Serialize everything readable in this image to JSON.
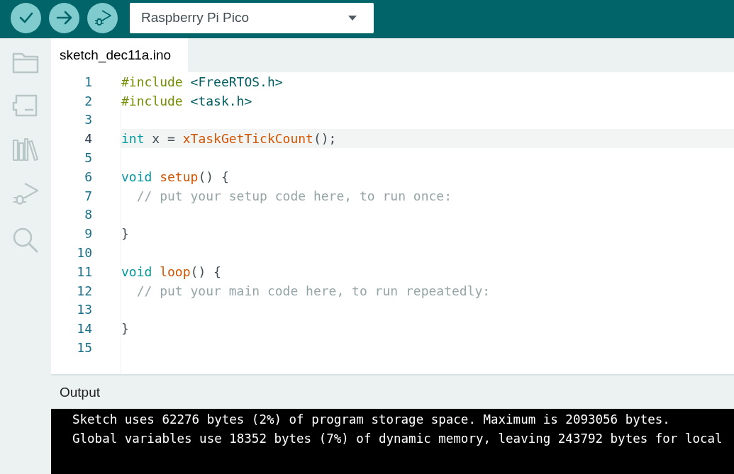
{
  "toolbar": {
    "board_selector": {
      "value": "Raspberry Pi Pico"
    }
  },
  "tabs": [
    {
      "label": "sketch_dec11a.ino",
      "selected": true
    }
  ],
  "editor": {
    "lines": [
      {
        "number": "1",
        "current": false,
        "tokens": [
          {
            "text": "#include",
            "kind": "directive"
          },
          {
            "text": " <FreeRTOS.h>",
            "kind": "header"
          }
        ]
      },
      {
        "number": "2",
        "current": false,
        "tokens": [
          {
            "text": "#include",
            "kind": "directive"
          },
          {
            "text": " <task.h>",
            "kind": "header"
          }
        ]
      },
      {
        "number": "3",
        "current": false
      },
      {
        "number": "4",
        "current": true,
        "tokens": [
          {
            "text": "int",
            "kind": "keyword"
          },
          {
            "text": " x = ",
            "kind": "plain"
          },
          {
            "text": "xTaskGetTickCount",
            "kind": "function"
          },
          {
            "text": "();",
            "kind": "plain"
          }
        ]
      },
      {
        "number": "5",
        "current": false
      },
      {
        "number": "6",
        "current": false,
        "tokens": [
          {
            "text": "void ",
            "kind": "keyword"
          },
          {
            "text": "setup",
            "kind": "function"
          },
          {
            "text": "() {",
            "kind": "plain"
          }
        ]
      },
      {
        "number": "7",
        "current": false,
        "tokens": [
          {
            "text": "  // put your setup code here, to run once:",
            "kind": "comment"
          }
        ]
      },
      {
        "number": "8",
        "current": false
      },
      {
        "number": "9",
        "current": false,
        "tokens": [
          {
            "text": "}",
            "kind": "plain"
          }
        ]
      },
      {
        "number": "10",
        "current": false
      },
      {
        "number": "11",
        "current": false,
        "tokens": [
          {
            "text": "void ",
            "kind": "keyword"
          },
          {
            "text": "loop",
            "kind": "function"
          },
          {
            "text": "() {",
            "kind": "plain"
          }
        ]
      },
      {
        "number": "12",
        "current": false,
        "tokens": [
          {
            "text": "  // put your main code here, to run repeatedly:",
            "kind": "comment"
          }
        ]
      },
      {
        "number": "13",
        "current": false
      },
      {
        "number": "14",
        "current": false,
        "tokens": [
          {
            "text": "}",
            "kind": "plain"
          }
        ]
      },
      {
        "number": "15",
        "current": false
      }
    ]
  },
  "output": {
    "title": "Output",
    "lines": [
      "Sketch uses 62276 bytes (2%) of program storage space. Maximum is 2093056 bytes.",
      "Global variables use 18352 bytes (7%) of dynamic memory, leaving 243792 bytes for local"
    ]
  }
}
